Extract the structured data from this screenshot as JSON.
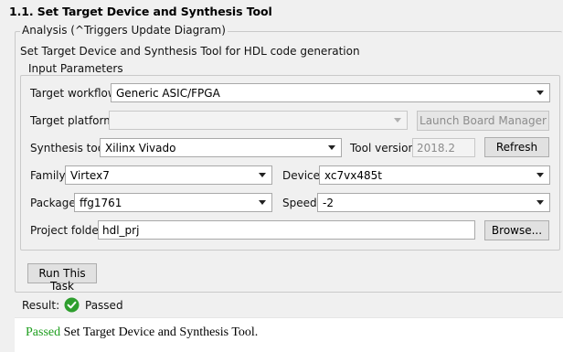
{
  "title": "1.1. Set Target Device and Synthesis Tool",
  "analysis": {
    "legend": "Analysis (^Triggers Update Diagram)",
    "description": "Set Target Device and Synthesis Tool for HDL code generation"
  },
  "input_parameters": {
    "legend": "Input Parameters",
    "target_workflow": {
      "label": "Target workflow:",
      "value": "Generic ASIC/FPGA"
    },
    "target_platform": {
      "label": "Target platform:",
      "value": ""
    },
    "launch_board_manager_label": "Launch Board Manager",
    "synthesis_tool": {
      "label": "Synthesis tool:",
      "value": "Xilinx Vivado"
    },
    "tool_version": {
      "label": "Tool version:",
      "value": "2018.2"
    },
    "refresh_label": "Refresh",
    "family": {
      "label": "Family:",
      "value": "Virtex7"
    },
    "device": {
      "label": "Device:",
      "value": "xc7vx485t"
    },
    "package": {
      "label": "Package:",
      "value": "ffg1761"
    },
    "speed": {
      "label": "Speed:",
      "value": "-2"
    },
    "project_folder": {
      "label": "Project folder:",
      "value": "hdl_prj"
    },
    "browse_label": "Browse..."
  },
  "run_task_label": "Run This Task",
  "result": {
    "label": "Result:",
    "status": "Passed",
    "status_color": "#1e9e1e",
    "message_status": "Passed",
    "message_text": " Set Target Device and Synthesis Tool."
  }
}
